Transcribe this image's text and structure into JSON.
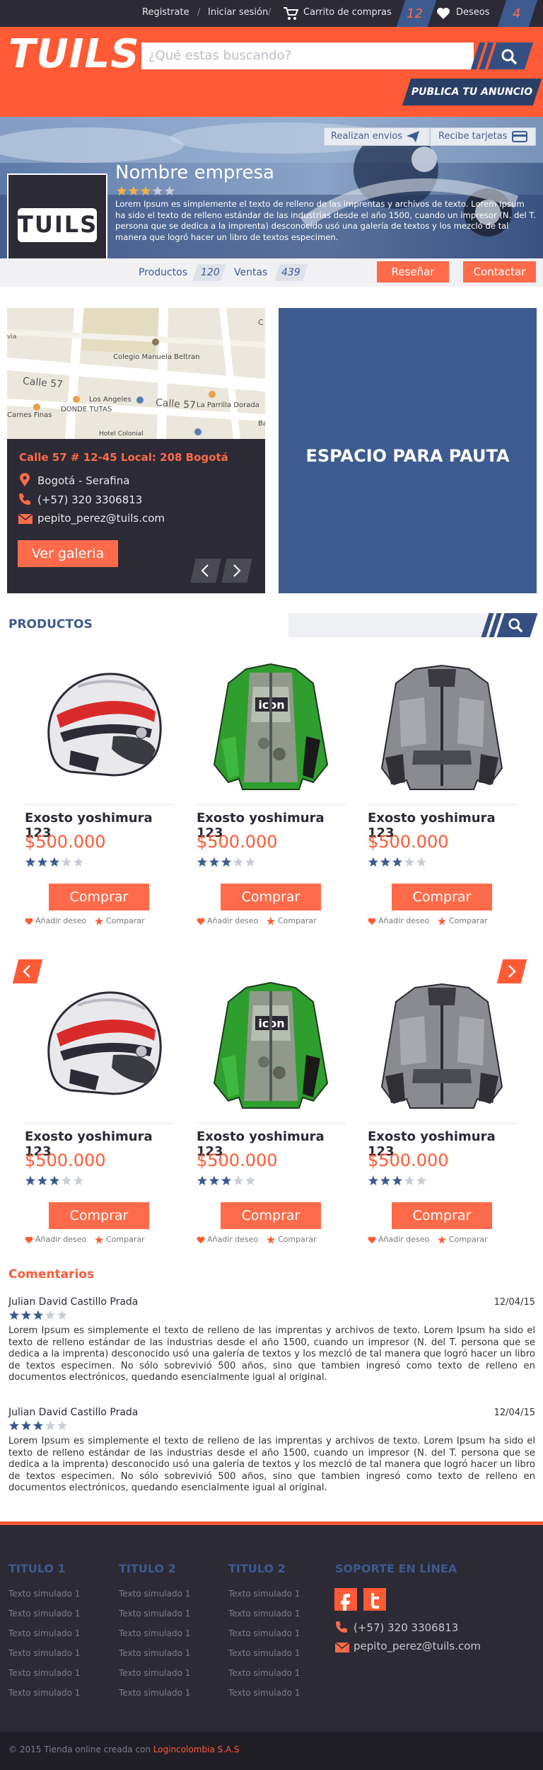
{
  "topbar": {
    "register": "Registrate",
    "login": "Iniciar sesión",
    "cart": "Carrito de compras",
    "cart_count": "12",
    "wishlist": "Deseos",
    "wishlist_count": "4"
  },
  "header": {
    "logo": "TUILS",
    "search_placeholder": "¿Qué estas buscando?",
    "publish": "PUBLICA TU ANUNCIO"
  },
  "store": {
    "logo_text": "TUILS",
    "name": "Nombre empresa",
    "rating": 3,
    "description": "Lorem Ipsum es simplemente el texto de relleno de las imprentas y archivos de texto. Lorem Ipsum ha sido el texto de relleno estándar de las industrias desde el año 1500, cuando un impresor (N. del T. persona que se dedica a la imprenta) desconocido usó una galería de textos y los mezcló de tal manera que logró hacer un libro de textos especimen.",
    "shipping": "Realizan envios",
    "cards": "Recibe tarjetas",
    "products_label": "Productos",
    "products_count": "120",
    "sales_label": "Ventas",
    "sales_count": "439",
    "review_btn": "Reseñar",
    "contact_btn": "Contactar"
  },
  "map": {
    "streets": [
      "Calle 57",
      "Calle 57",
      "Colegio Manuela Beltran",
      "Los Angeles",
      "DONDE TUTAS",
      "La Parrilla Dorada",
      "Carnes Finas",
      "Hotel Colonial",
      "via",
      "C",
      "Ba"
    ]
  },
  "contact": {
    "address": "Calle 57 # 12-45 Local: 208 Bogotá",
    "city": "Bogotá - Serafina",
    "phone": "(+57) 320 3306813",
    "email": "pepito_perez@tuils.com",
    "gallery_btn": "Ver galeria"
  },
  "ad": {
    "label": "ESPACIO PARA PAUTA"
  },
  "products": {
    "title": "PRODUCTOS",
    "items": [
      {
        "name": "Exosto yoshimura 123",
        "price": "$500.000",
        "rating": 3,
        "buy": "Comprar",
        "wish": "Añadir deseo",
        "compare": "Comparar",
        "image": "helmet"
      },
      {
        "name": "Exosto yoshimura 123",
        "price": "$500.000",
        "rating": 3,
        "buy": "Comprar",
        "wish": "Añadir deseo",
        "compare": "Comparar",
        "image": "green-jacket"
      },
      {
        "name": "Exosto yoshimura 123",
        "price": "$500.000",
        "rating": 3,
        "buy": "Comprar",
        "wish": "Añadir deseo",
        "compare": "Comparar",
        "image": "grey-jacket"
      },
      {
        "name": "Exosto yoshimura 123",
        "price": "$500.000",
        "rating": 3,
        "buy": "Comprar",
        "wish": "Añadir deseo",
        "compare": "Comparar",
        "image": "helmet"
      },
      {
        "name": "Exosto yoshimura 123",
        "price": "$500.000",
        "rating": 3,
        "buy": "Comprar",
        "wish": "Añadir deseo",
        "compare": "Comparar",
        "image": "green-jacket"
      },
      {
        "name": "Exosto yoshimura 123",
        "price": "$500.000",
        "rating": 3,
        "buy": "Comprar",
        "wish": "Añadir deseo",
        "compare": "Comparar",
        "image": "grey-jacket"
      }
    ]
  },
  "comments": {
    "title": "Comentarios",
    "items": [
      {
        "author": "Julian David Castillo Prada",
        "date": "12/04/15",
        "rating": 3,
        "text": "Lorem Ipsum es simplemente el texto de relleno de las imprentas y archivos de texto. Lorem Ipsum ha sido el texto de relleno estándar de las industrias desde el año 1500, cuando un impresor (N. del T. persona que se dedica a la imprenta) desconocido usó una galería de textos y los mezcló de tal manera que logró hacer un libro de textos especimen. No sólo sobrevivió 500 años, sino que tambien ingresó como texto de relleno en documentos electrónicos, quedando esencialmente igual al original."
      },
      {
        "author": "Julian David Castillo Prada",
        "date": "12/04/15",
        "rating": 3,
        "text": "Lorem Ipsum es simplemente el texto de relleno de las imprentas y archivos de texto. Lorem Ipsum ha sido el texto de relleno estándar de las industrias desde el año 1500, cuando un impresor (N. del T. persona que se dedica a la imprenta) desconocido usó una galería de textos y los mezcló de tal manera que logró hacer un libro de textos especimen. No sólo sobrevivió 500 años, sino que tambien ingresó como texto de relleno en documentos electrónicos, quedando esencialmente igual al original."
      }
    ]
  },
  "footer": {
    "columns": [
      {
        "title": "TITULO 1",
        "items": [
          "Texto simulado 1",
          "Texto simulado 1",
          "Texto simulado 1",
          "Texto simulado 1",
          "Texto simulado 1",
          "Texto simulado 1"
        ]
      },
      {
        "title": "TITULO 2",
        "items": [
          "Texto simulado 1",
          "Texto simulado 1",
          "Texto simulado 1",
          "Texto simulado 1",
          "Texto simulado 1",
          "Texto simulado 1"
        ]
      },
      {
        "title": "TITULO 2",
        "items": [
          "Texto simulado 1",
          "Texto simulado 1",
          "Texto simulado 1",
          "Texto simulado 1",
          "Texto simulado 1",
          "Texto simulado 1"
        ]
      }
    ],
    "support_title": "SOPORTE EN LÍNEA",
    "phone": "(+57) 320 3306813",
    "email": "pepito_perez@tuils.com",
    "copyright": "© 2015 Tienda online creada con ",
    "copyright_link": "Logincolombia S.A.S"
  },
  "colors": {
    "accent": "#ff5a36",
    "navy": "#3d5b8f",
    "dark": "#2b2a35"
  }
}
